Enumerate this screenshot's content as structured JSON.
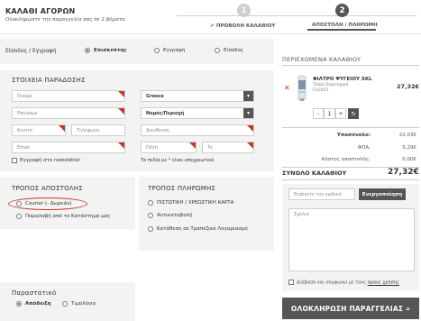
{
  "header": {
    "title": "ΚΑΛΑΘΙ ΑΓΟΡΩΝ",
    "subtitle": "Ολοκληρώστε την παραγγελία σας σε 2 βήματα",
    "steps": [
      {
        "number": "1",
        "label": "ΠΡΟΒΟΛΗ ΚΑΛΑΘΙΟΥ",
        "done": true
      },
      {
        "number": "2",
        "label": "ΑΠΟΣΤΟΛΗ / ΠΛΗΡΩΜΗ",
        "active": true
      }
    ]
  },
  "login": {
    "label": "Είσοδος / Εγγραφή",
    "options": [
      {
        "label": "Επισκέπτης",
        "selected": true
      },
      {
        "label": "Εγγραφή",
        "selected": false
      },
      {
        "label": "Είσοδος",
        "selected": false
      }
    ]
  },
  "delivery": {
    "title": "ΣΤΟΙΧΕΙΑ ΠΑΡΑΔΟΣΗΣ",
    "fields": {
      "name": "Όνομα",
      "country": "Greece",
      "surname": "Επώνυμο",
      "prefecture": "Νομός/Περιοχή",
      "mobile": "Κινητό",
      "phone": "Τηλέφωνο",
      "address": "Διεύθυνση",
      "email": "Email",
      "city": "Πόλη",
      "zip": "Τκ"
    },
    "newsletter_label": "Εγγραφή στο newsletter",
    "required_note": "Τα πεδία με * είναι υποχρεωτικά"
  },
  "shipping": {
    "title": "ΤΡΟΠΟΣ ΑΠΟΣΤΟΛΗΣ",
    "options": [
      {
        "label": "Courier (- Δωρεάν)"
      },
      {
        "label": "Παραλαβή από το Κατάστημα μας"
      }
    ]
  },
  "payment": {
    "title": "ΤΡΟΠΟΣ ΠΛΗΡΩΜΗΣ",
    "options": [
      {
        "label": "ΠΙΣΤΩΤΙΚΗ / ΧΡΕΩΣΤΙΚΗ ΚΑΡΤΑ"
      },
      {
        "label": "Αντικαταβολή"
      },
      {
        "label": "Κατάθεση σε Τραπεζικό Λογαριασμό"
      }
    ]
  },
  "receipt": {
    "title": "Παραστατικό",
    "options": [
      {
        "label": "Απόδειξη",
        "selected": true
      },
      {
        "label": "Τιμολόγιο",
        "selected": false
      }
    ]
  },
  "cart": {
    "title": "ΠΕΡΙΕΧΟΜΕΝΑ ΚΑΛΑΘΙΟΥ",
    "item": {
      "name": "ΦΙΛΤΡΟ ΨΥΓΕΙΟΥ SKL",
      "sub": "Τύπος Εσωτερικό",
      "code": "FLG015",
      "price": "27,32€",
      "qty": "1",
      "minus": "-",
      "plus": "+",
      "remove": "✕",
      "refresh": "↻"
    },
    "summary": [
      {
        "label": "Υποσύνολο:",
        "value": "22,03€"
      },
      {
        "label": "ΦΠΑ:",
        "value": "5,29€"
      },
      {
        "label": "Κόστος αποστολής:",
        "value": "0,00€"
      }
    ],
    "total_label": "ΣΥΝΟΛΟ ΚΑΛΑΘΙΟΥ",
    "total_value": "27,32€",
    "coupon_placeholder": "Εισάγετε τον κωδικό",
    "coupon_button": "Ενεργοποίηση",
    "comments_placeholder": "Σχόλια",
    "terms_prefix": "Διάβασα και συμφωνώ με τους ",
    "terms_link": "όρους χρήσης",
    "submit": "ΟΛΟΚΛΗΡΩΣΗ ΠΑΡΑΓΓΕΛΙΑΣ »"
  },
  "colors": {
    "accent_dark": "#555555",
    "success": "#3aa13a",
    "required": "#c0392b",
    "panel_bg": "#f3f3f3"
  }
}
